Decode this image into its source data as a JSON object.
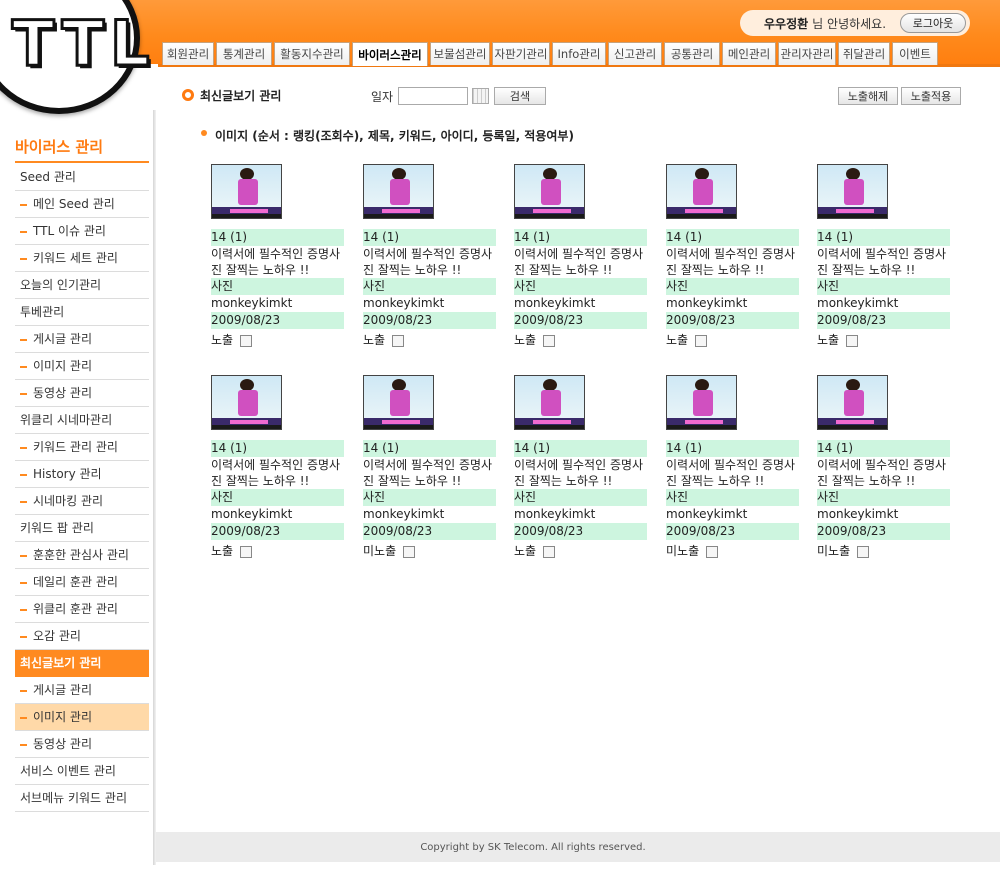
{
  "header": {
    "logo": "TTL",
    "user_name": "우우정환",
    "greeting": "님 안녕하세요.",
    "logout_label": "로그아웃",
    "tabs": [
      "회원관리",
      "통계관리",
      "활동지수관리",
      "바이러스관리",
      "보물섬관리",
      "자판기관리",
      "Info관리",
      "신고관리",
      "공통관리",
      "메인관리",
      "관리자관리",
      "쥐달관리",
      "이벤트"
    ],
    "active_tab": "바이러스관리"
  },
  "sidebar": {
    "title": "바이러스 관리",
    "items": [
      {
        "label": "Seed 관리",
        "sub": false
      },
      {
        "label": "메인 Seed 관리",
        "sub": true
      },
      {
        "label": "TTL 이슈 관리",
        "sub": true
      },
      {
        "label": "키워드 세트 관리",
        "sub": true
      },
      {
        "label": "오늘의 인기관리",
        "sub": false
      },
      {
        "label": "투베관리",
        "sub": false
      },
      {
        "label": "게시글 관리",
        "sub": true
      },
      {
        "label": "이미지 관리",
        "sub": true
      },
      {
        "label": "동영상 관리",
        "sub": true
      },
      {
        "label": "위클리 시네마관리",
        "sub": false
      },
      {
        "label": "키워드 관리 관리",
        "sub": true
      },
      {
        "label": "History 관리",
        "sub": true
      },
      {
        "label": "시네마킹 관리",
        "sub": true
      },
      {
        "label": "키워드 팝 관리",
        "sub": false
      },
      {
        "label": "훈훈한 관심사 관리",
        "sub": true
      },
      {
        "label": "데일리 훈관 관리",
        "sub": true
      },
      {
        "label": "위클리 훈관 관리",
        "sub": true
      },
      {
        "label": "오감 관리",
        "sub": true
      },
      {
        "label": "최신글보기 관리",
        "sub": false,
        "state": "active-main"
      },
      {
        "label": "게시글 관리",
        "sub": true
      },
      {
        "label": "이미지 관리",
        "sub": true,
        "state": "active-sub"
      },
      {
        "label": "동영상 관리",
        "sub": true
      },
      {
        "label": "서비스 이벤트 관리",
        "sub": false
      },
      {
        "label": "서브메뉴 키워드 관리",
        "sub": false
      }
    ]
  },
  "toolbar": {
    "page_title": "최신글보기 관리",
    "date_label": "일자",
    "date_value": "",
    "search_label": "검색",
    "hide_label": "노출해제",
    "apply_label": "노출적용"
  },
  "section": {
    "title": "이미지 (순서 : 랭킹(조회수), 제목, 키워드, 아이디, 등록일, 적용여부)"
  },
  "cards": [
    {
      "rank": "14 (1)",
      "title": "이력서에 필수적인 증명사진 잘찍는 노하우 !!",
      "keyword": "사진",
      "user": "monkeykimkt",
      "date": "2009/08/23",
      "status": "노출"
    },
    {
      "rank": "14 (1)",
      "title": "이력서에 필수적인 증명사진 잘찍는 노하우 !!",
      "keyword": "사진",
      "user": "monkeykimkt",
      "date": "2009/08/23",
      "status": "노출"
    },
    {
      "rank": "14 (1)",
      "title": "이력서에 필수적인 증명사진 잘찍는 노하우 !!",
      "keyword": "사진",
      "user": "monkeykimkt",
      "date": "2009/08/23",
      "status": "노출"
    },
    {
      "rank": "14 (1)",
      "title": "이력서에 필수적인 증명사진 잘찍는 노하우 !!",
      "keyword": "사진",
      "user": "monkeykimkt",
      "date": "2009/08/23",
      "status": "노출"
    },
    {
      "rank": "14 (1)",
      "title": "이력서에 필수적인 증명사진 잘찍는 노하우 !!",
      "keyword": "사진",
      "user": "monkeykimkt",
      "date": "2009/08/23",
      "status": "노출"
    },
    {
      "rank": "14 (1)",
      "title": "이력서에 필수적인 증명사진 잘찍는 노하우 !!",
      "keyword": "사진",
      "user": "monkeykimkt",
      "date": "2009/08/23",
      "status": "노출"
    },
    {
      "rank": "14 (1)",
      "title": "이력서에 필수적인 증명사진 잘찍는 노하우 !!",
      "keyword": "사진",
      "user": "monkeykimkt",
      "date": "2009/08/23",
      "status": "미노출"
    },
    {
      "rank": "14 (1)",
      "title": "이력서에 필수적인 증명사진 잘찍는 노하우 !!",
      "keyword": "사진",
      "user": "monkeykimkt",
      "date": "2009/08/23",
      "status": "노출"
    },
    {
      "rank": "14 (1)",
      "title": "이력서에 필수적인 증명사진 잘찍는 노하우 !!",
      "keyword": "사진",
      "user": "monkeykimkt",
      "date": "2009/08/23",
      "status": "미노출"
    },
    {
      "rank": "14 (1)",
      "title": "이력서에 필수적인 증명사진 잘찍는 노하우 !!",
      "keyword": "사진",
      "user": "monkeykimkt",
      "date": "2009/08/23",
      "status": "미노출"
    }
  ],
  "footer": {
    "copyright": "Copyright by SK Telecom.  All rights reserved."
  },
  "colors": {
    "accent": "#ff8a20",
    "highlight_row": "#cdf5df",
    "active_sub": "#ffd9a8"
  }
}
